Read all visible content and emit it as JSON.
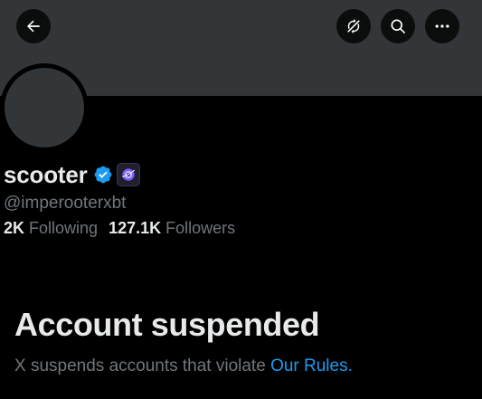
{
  "header": {
    "icons": {
      "back": "arrow-left-icon",
      "rotate": "rotate-icon",
      "search": "search-icon",
      "more": "more-dots-icon"
    }
  },
  "profile": {
    "display_name": "scooter",
    "handle": "@imperooterxbt",
    "verified_badge": "verified-icon",
    "affiliate_badge": "affiliate-icon",
    "following": {
      "count": "2K",
      "label": "Following"
    },
    "followers": {
      "count": "127.1K",
      "label": "Followers"
    }
  },
  "notice": {
    "title": "Account suspended",
    "description": "X suspends accounts that violate ",
    "link_text": "Our Rules",
    "trailing": "."
  },
  "colors": {
    "background": "#000000",
    "banner": "#333639",
    "primary_text": "#e7e9ea",
    "secondary_text": "#71767b",
    "link": "#1d9bf0",
    "verified": "#1d9bf0"
  }
}
